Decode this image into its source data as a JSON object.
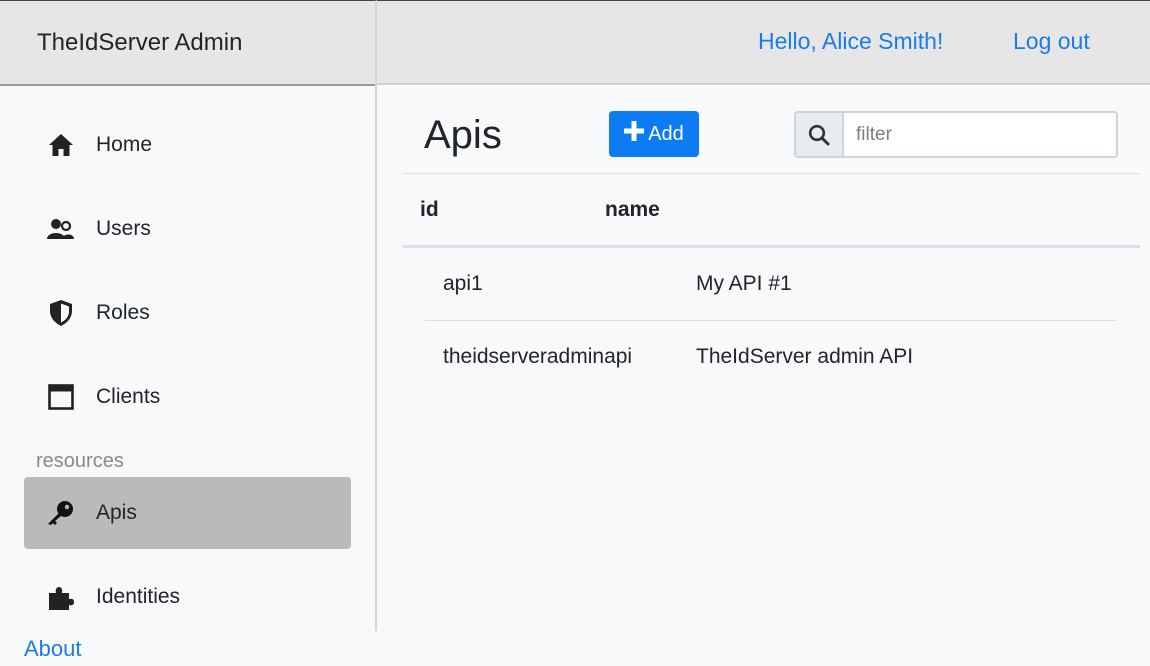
{
  "brand": "TheIdServer Admin",
  "header": {
    "greeting": "Hello, Alice Smith!",
    "logout": "Log out"
  },
  "sidebar": {
    "items": [
      {
        "label": "Home",
        "icon": "home-icon"
      },
      {
        "label": "Users",
        "icon": "users-icon"
      },
      {
        "label": "Roles",
        "icon": "shield-icon"
      },
      {
        "label": "Clients",
        "icon": "window-icon"
      }
    ],
    "section_label": "resources",
    "resources": [
      {
        "label": "Apis",
        "icon": "key-icon",
        "active": true
      },
      {
        "label": "Identities",
        "icon": "puzzle-icon"
      }
    ],
    "about": "About"
  },
  "main": {
    "title": "Apis",
    "add_label": "Add",
    "filter_placeholder": "filter",
    "table": {
      "columns": [
        "id",
        "name"
      ],
      "rows": [
        {
          "id": "api1",
          "name": "My API #1"
        },
        {
          "id": "theidserveradminapi",
          "name": "TheIdServer admin API"
        }
      ]
    }
  },
  "colors": {
    "accent": "#0d7cf2",
    "link": "#1a7ce8",
    "active_nav": "#bababa",
    "header_bg": "#e6e6e6"
  }
}
